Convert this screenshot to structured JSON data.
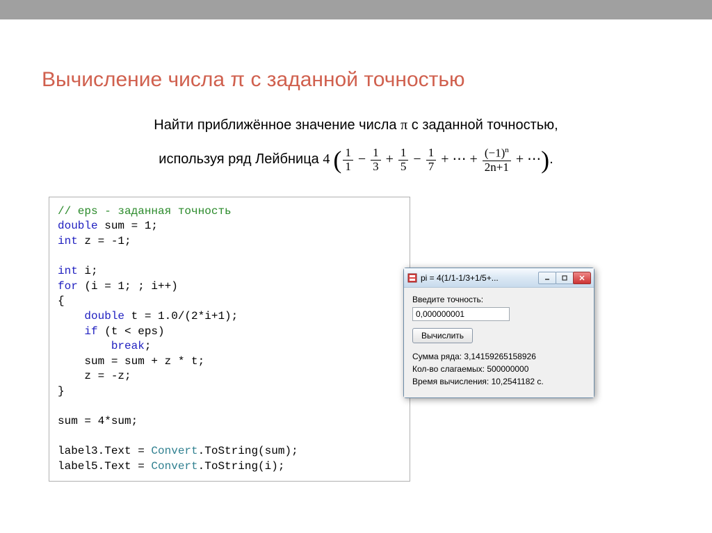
{
  "title": "Вычисление числа π с заданной точностью",
  "task": {
    "line1_pre": "Найти приближённое значение числа ",
    "pi": "π",
    "line1_post": " с заданной точностью,",
    "line2_pre": "используя ряд Лейбница ",
    "four": "4",
    "frac1": {
      "n": "1",
      "d": "1"
    },
    "op1": " − ",
    "frac2": {
      "n": "1",
      "d": "3"
    },
    "op2": " + ",
    "frac3": {
      "n": "1",
      "d": "5"
    },
    "op3": " − ",
    "frac4": {
      "n": "1",
      "d": "7"
    },
    "op4": " + ⋯ + ",
    "fracn": {
      "n_base": "(−1)",
      "n_sup": "n",
      "d": "2n+1"
    },
    "op5": " + ⋯",
    "dot": "."
  },
  "code": {
    "l1": "// eps - заданная точность",
    "l2a": "double",
    "l2b": " sum = 1;",
    "l3a": "int",
    "l3b": " z = -1;",
    "l4": "",
    "l5a": "int",
    "l5b": " i;",
    "l6a": "for",
    "l6b": " (i = 1; ; i++)",
    "l7": "{",
    "l8a": "    ",
    "l8b": "double",
    "l8c": " t = 1.0/(2*i+1);",
    "l9a": "    ",
    "l9b": "if",
    "l9c": " (t < eps)",
    "l10a": "        ",
    "l10b": "break",
    "l10c": ";",
    "l11": "    sum = sum + z * t;",
    "l12": "    z = -z;",
    "l13": "}",
    "l14": "",
    "l15": "sum = 4*sum;",
    "l16": "",
    "l17a": "label3.Text = ",
    "l17b": "Convert",
    "l17c": ".ToString(sum);",
    "l18a": "label5.Text = ",
    "l18b": "Convert",
    "l18c": ".ToString(i);"
  },
  "win": {
    "title": "pi = 4(1/1-1/3+1/5+...",
    "label_eps": "Введите точность:",
    "input_eps": "0,000000001",
    "btn_calc": "Вычислить",
    "res_sum_label": "Сумма ряда:  ",
    "res_sum_val": "3,14159265158926",
    "res_n_label": "Кол-во слагаемых:  ",
    "res_n_val": "500000000",
    "res_time_label": "Время вычисления:  ",
    "res_time_val": "10,2541182 с."
  }
}
